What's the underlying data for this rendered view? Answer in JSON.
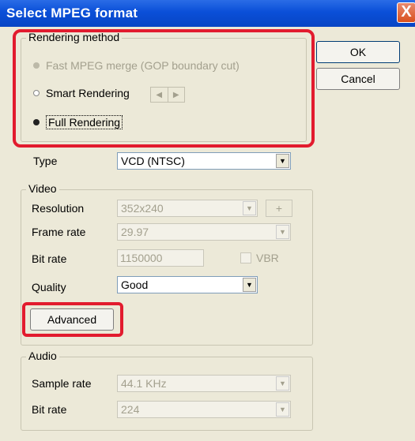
{
  "window": {
    "title": "Select MPEG format",
    "close_label": "X"
  },
  "buttons": {
    "ok": "OK",
    "cancel": "Cancel"
  },
  "rendering": {
    "group_label": "Rendering method",
    "options": [
      {
        "label": "Fast MPEG merge (GOP boundary cut)",
        "state": "disabled"
      },
      {
        "label": "Smart Rendering",
        "state": "unselected"
      },
      {
        "label": "Full Rendering",
        "state": "selected"
      }
    ],
    "arrows": {
      "left": "◀",
      "right": "▶"
    }
  },
  "type": {
    "label": "Type",
    "value": "VCD (NTSC)"
  },
  "video": {
    "group_label": "Video",
    "resolution": {
      "label": "Resolution",
      "value": "352x240",
      "plus": "+"
    },
    "frame_rate": {
      "label": "Frame rate",
      "value": "29.97"
    },
    "bit_rate": {
      "label": "Bit rate",
      "value": "1150000",
      "vbr": "VBR"
    },
    "quality": {
      "label": "Quality",
      "value": "Good"
    },
    "advanced": "Advanced"
  },
  "audio": {
    "group_label": "Audio",
    "sample_rate": {
      "label": "Sample rate",
      "value": "44.1 KHz"
    },
    "bit_rate": {
      "label": "Bit rate",
      "value": "224"
    }
  },
  "colors": {
    "highlight": "#e21b2e",
    "titlebar": "#0a4fd8"
  }
}
